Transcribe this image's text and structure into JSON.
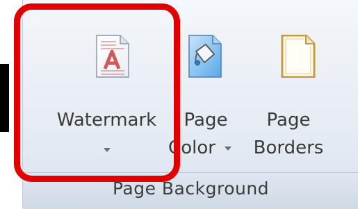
{
  "ribbon": {
    "group_label": "Page Background",
    "buttons": {
      "watermark": {
        "label": "Watermark",
        "icon": "watermark-icon"
      },
      "page_color": {
        "line1": "Page",
        "line2": "Color",
        "icon": "page-color-icon"
      },
      "page_borders": {
        "line1": "Page",
        "line2": "Borders",
        "icon": "page-borders-icon"
      }
    }
  },
  "colors": {
    "highlight": "#e00000",
    "ribbon_bg": "#e5ebf3",
    "text": "#3a3a3a"
  }
}
